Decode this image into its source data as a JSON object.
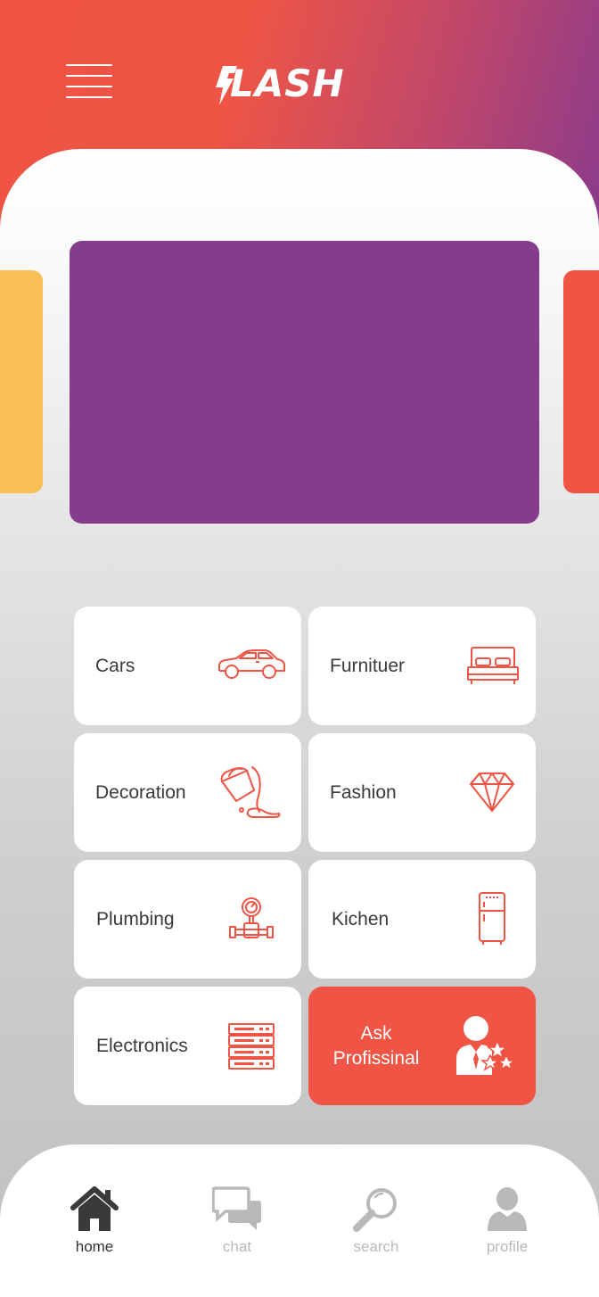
{
  "app": {
    "logo_text": "LASH"
  },
  "colors": {
    "accent": "#ef5444",
    "banner": "#853c8b",
    "secondary": "#f9bf54"
  },
  "categories": [
    {
      "label": "Cars",
      "icon": "car-icon"
    },
    {
      "label": "Furnituer",
      "icon": "bed-icon"
    },
    {
      "label": "Decoration",
      "icon": "paint-bucket-icon"
    },
    {
      "label": "Fashion",
      "icon": "diamond-icon"
    },
    {
      "label": "Plumbing",
      "icon": "pipe-gauge-icon"
    },
    {
      "label": "Kichen",
      "icon": "fridge-icon"
    },
    {
      "label": "Electronics",
      "icon": "server-rack-icon"
    }
  ],
  "ask": {
    "line1": "Ask",
    "line2": "Profissinal",
    "icon": "professional-stars-icon"
  },
  "nav": [
    {
      "label": "home",
      "icon": "home-icon",
      "active": true
    },
    {
      "label": "chat",
      "icon": "chat-icon",
      "active": false
    },
    {
      "label": "search",
      "icon": "search-icon",
      "active": false
    },
    {
      "label": "profile",
      "icon": "profile-icon",
      "active": false
    }
  ]
}
